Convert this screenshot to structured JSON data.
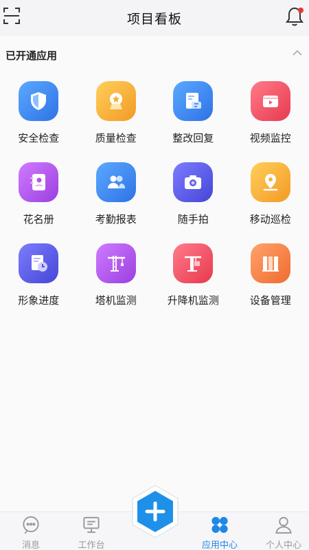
{
  "header": {
    "title": "项目看板",
    "scan_icon": "scan-icon",
    "bell_icon": "bell-icon",
    "badge_color": "#e53935"
  },
  "section": {
    "title": "已开通应用",
    "collapse_icon": "chevron-up-icon"
  },
  "apps": [
    {
      "label": "安全检查",
      "icon": "shield-icon",
      "color": "#3f8ef0"
    },
    {
      "label": "质量检查",
      "icon": "award-icon",
      "color": "#f5b23a"
    },
    {
      "label": "整改回复",
      "icon": "document-edit-icon",
      "color": "#3f8ef0"
    },
    {
      "label": "视频监控",
      "icon": "video-icon",
      "color": "#f0556a"
    },
    {
      "label": "花名册",
      "icon": "contact-book-icon",
      "color": "#b455e6"
    },
    {
      "label": "考勤报表",
      "icon": "users-icon",
      "color": "#3f8ef0"
    },
    {
      "label": "随手拍",
      "icon": "camera-icon",
      "color": "#5b5ce6"
    },
    {
      "label": "移动巡检",
      "icon": "location-pin-icon",
      "color": "#f7b33b"
    },
    {
      "label": "形象进度",
      "icon": "progress-clock-icon",
      "color": "#5b5ce6"
    },
    {
      "label": "塔机监测",
      "icon": "tower-crane-icon",
      "color": "#b455e6"
    },
    {
      "label": "升降机监测",
      "icon": "elevator-icon",
      "color": "#f0556a"
    },
    {
      "label": "设备管理",
      "icon": "equipment-icon",
      "color": "#f78a4f"
    }
  ],
  "tabbar": {
    "active_color": "#1e88e5",
    "tabs": [
      {
        "label": "消息",
        "icon": "message-icon"
      },
      {
        "label": "工作台",
        "icon": "monitor-icon"
      },
      {
        "label": "应用中心",
        "icon": "app-center-icon"
      },
      {
        "label": "个人中心",
        "icon": "user-icon"
      }
    ],
    "fab_icon": "plus-icon"
  }
}
